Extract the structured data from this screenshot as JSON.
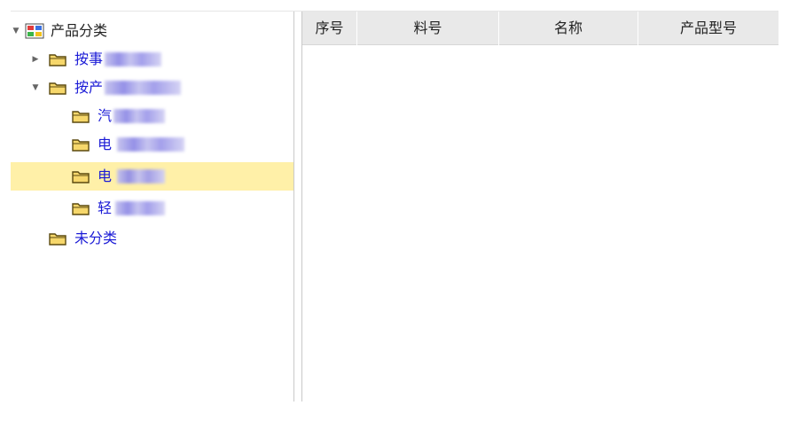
{
  "tree": {
    "root": {
      "label": "产品分类",
      "icon": "category-grid-icon",
      "expanded": true
    },
    "nodes": [
      {
        "label": "按事",
        "icon": "folder-icon",
        "expanded": false,
        "redacted": true
      },
      {
        "label": "按产",
        "icon": "folder-icon",
        "expanded": true,
        "redacted": true
      },
      {
        "label": "汽",
        "icon": "folder-icon",
        "redacted": true
      },
      {
        "label": "电",
        "icon": "folder-icon",
        "redacted": true
      },
      {
        "label": "电",
        "icon": "folder-icon",
        "redacted": true,
        "selected": true
      },
      {
        "label": "轻",
        "icon": "folder-icon",
        "redacted": true
      },
      {
        "label": "未分类",
        "icon": "folder-icon",
        "redacted": false
      }
    ]
  },
  "grid": {
    "columns": [
      "序号",
      "料号",
      "名称",
      "产品型号"
    ],
    "rows": []
  },
  "colors": {
    "selected_row": "#fff0a8",
    "node_text": "#1a1ad6",
    "header_bg": "#e9e9e9",
    "folder_fill": "#f6d76b",
    "folder_stroke": "#5b4a10"
  }
}
